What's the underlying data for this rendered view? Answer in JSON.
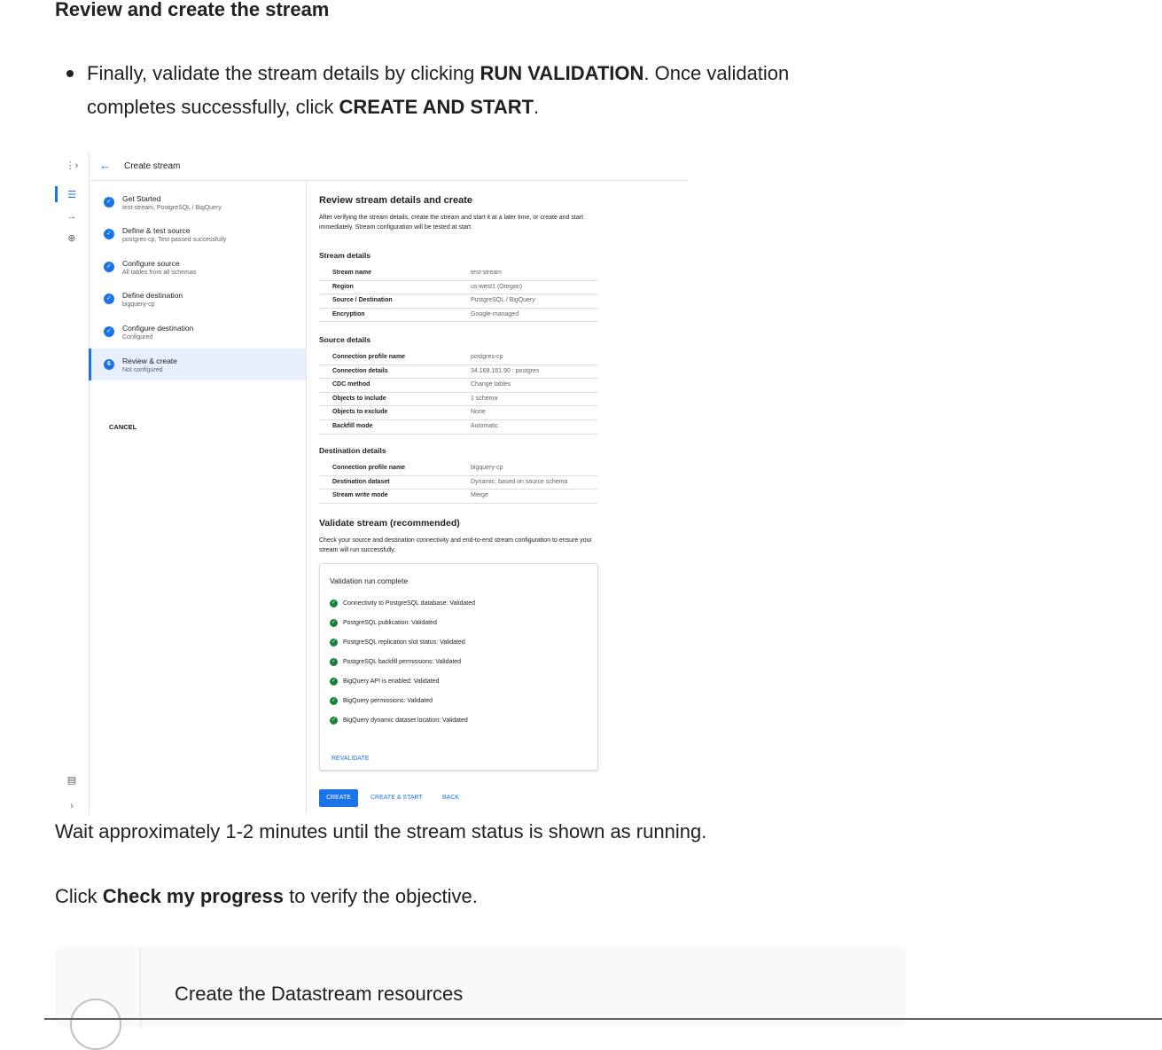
{
  "doc": {
    "heading": "Review and create the stream",
    "bullet": {
      "pre": "Finally, validate the stream details by clicking ",
      "b1": "RUN VALIDATION",
      "mid": ". Once validation completes successfully, click ",
      "b2": "CREATE AND START",
      "post": "."
    },
    "wait_text": "Wait approximately 1-2 minutes until the stream status is shown as running.",
    "click": {
      "pre": "Click ",
      "bold": "Check my progress",
      "post": " to verify the objective."
    },
    "check_card_title": "Create the Datastream resources"
  },
  "screenshot": {
    "title": "Create stream",
    "rail_icons": [
      "datastream-logo-icon",
      "list-icon",
      "arrow-icon",
      "globe-icon",
      "notes-icon",
      "expand-icon"
    ],
    "steps": [
      {
        "title": "Get Started",
        "sub": "test-stream, PostgreSQL / BigQuery",
        "marker": "✓"
      },
      {
        "title": "Define & test source",
        "sub": "postgres-cp, Test passed successfully",
        "marker": "✓"
      },
      {
        "title": "Configure source",
        "sub": "All tables from all schemas",
        "marker": "✓"
      },
      {
        "title": "Define destination",
        "sub": "bigquery-cp",
        "marker": "✓"
      },
      {
        "title": "Configure destination",
        "sub": "Configured",
        "marker": "✓"
      },
      {
        "title": "Review & create",
        "sub": "Not configured",
        "marker": "6"
      }
    ],
    "cancel": "CANCEL",
    "main": {
      "heading": "Review stream details and create",
      "intro": "After verifying the stream details, create the stream and start it at a later time, or create and start immediately. Stream configuration will be tested at start.",
      "stream_details": {
        "title": "Stream details",
        "rows": [
          {
            "k": "Stream name",
            "v": "test-stream"
          },
          {
            "k": "Region",
            "v": "us-west1 (Oregon)"
          },
          {
            "k": "Source / Destination",
            "v": "PostgreSQL / BigQuery"
          },
          {
            "k": "Encryption",
            "v": "Google-managed"
          }
        ]
      },
      "source_details": {
        "title": "Source details",
        "rows": [
          {
            "k": "Connection profile name",
            "v": "postgres-cp"
          },
          {
            "k": "Connection details",
            "v": "34.168.161.90 : postgres"
          },
          {
            "k": "CDC method",
            "v": "Change tables"
          },
          {
            "k": "Objects to include",
            "v": "1 schema"
          },
          {
            "k": "Objects to exclude",
            "v": "None"
          },
          {
            "k": "Backfill mode",
            "v": "Automatic"
          }
        ]
      },
      "destination_details": {
        "title": "Destination details",
        "rows": [
          {
            "k": "Connection profile name",
            "v": "bigquery-cp"
          },
          {
            "k": "Destination dataset",
            "v": "Dynamic, based on source schema"
          },
          {
            "k": "Stream write mode",
            "v": "Merge"
          }
        ]
      },
      "validate": {
        "heading": "Validate stream (recommended)",
        "text": "Check your source and destination connectivity and end-to-end stream configuration to ensure your stream will run successfully.",
        "card_title": "Validation run complete",
        "items": [
          "Connectivity to PostgreSQL database: Validated",
          "PostgreSQL publication: Validated",
          "PostgreSQL replication slot status: Validated",
          "PostgreSQL backfill permissions: Validated",
          "BigQuery API is enabled: Validated",
          "BigQuery permissions: Validated",
          "BigQuery dynamic dataset location: Validated"
        ],
        "revalidate": "REVALIDATE"
      },
      "buttons": {
        "create": "CREATE",
        "create_start": "CREATE & START",
        "back": "BACK"
      }
    }
  }
}
